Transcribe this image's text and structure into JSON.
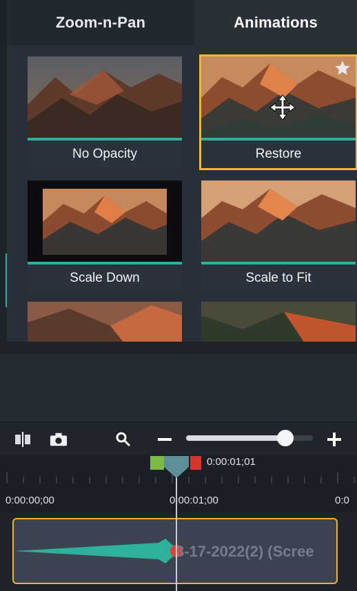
{
  "tabs": {
    "zoom": "Zoom-n-Pan",
    "animations": "Animations"
  },
  "cards": [
    {
      "label": "No Opacity"
    },
    {
      "label": "Restore"
    },
    {
      "label": "Scale Down"
    },
    {
      "label": "Scale to Fit"
    }
  ],
  "zoom_slider": {
    "value": 0.78
  },
  "timeline": {
    "current_time": "0:00:01;01",
    "tick_label_start": "0:00:00;00",
    "tick_label_mid": "0:00:01;00",
    "tick_label_end": "0:0",
    "clip_name": "3-17-2022(2) (Scree"
  },
  "colors": {
    "accent_teal": "#2fb29d",
    "selection": "#f2b627"
  }
}
